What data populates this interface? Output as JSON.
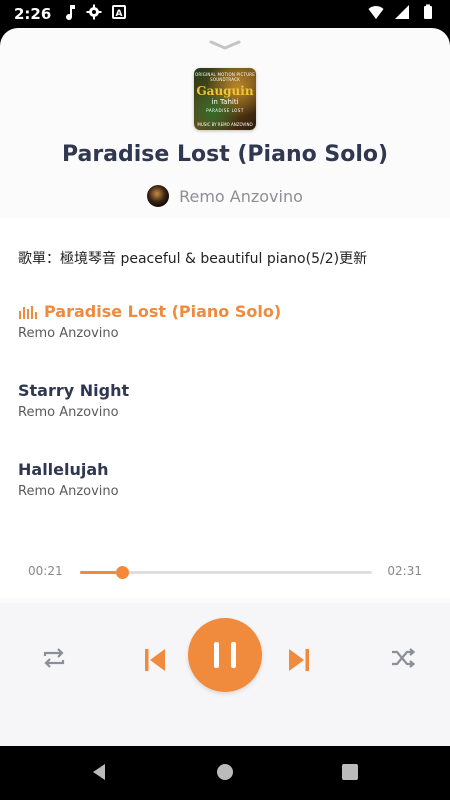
{
  "status_bar": {
    "time": "2:26",
    "icons": [
      "music-note-icon",
      "gear-icon",
      "a-box-icon",
      "wifi-icon",
      "signal-icon",
      "battery-icon"
    ],
    "a_icon_letter": "A"
  },
  "player": {
    "cover": {
      "top_text": "ORIGINAL MOTION PICTURE SOUNDTRACK",
      "title": "Gauguin",
      "subtitle": "in Tahiti",
      "line": "PARADISE LOST",
      "bottom_text": "MUSIC BY REMO ANZOVINO"
    },
    "song_title": "Paradise Lost (Piano Solo)",
    "artist": "Remo Anzovino"
  },
  "playlist": {
    "title": "歌單：極境琴音 peaceful & beautiful piano(5/2)更新",
    "tracks": [
      {
        "title": "Paradise Lost (Piano Solo)",
        "artist": "Remo Anzovino",
        "active": true
      },
      {
        "title": "Starry Night",
        "artist": "Remo Anzovino",
        "active": false
      },
      {
        "title": "Hallelujah",
        "artist": "Remo Anzovino",
        "active": false
      }
    ]
  },
  "progress": {
    "current": "00:21",
    "total": "02:31",
    "fraction": 0.145
  },
  "colors": {
    "accent": "#f08a3c",
    "title": "#303750",
    "muted": "#8e8e95"
  },
  "controls": [
    "repeat-icon",
    "previous-icon",
    "pause-icon",
    "next-icon",
    "shuffle-icon"
  ]
}
